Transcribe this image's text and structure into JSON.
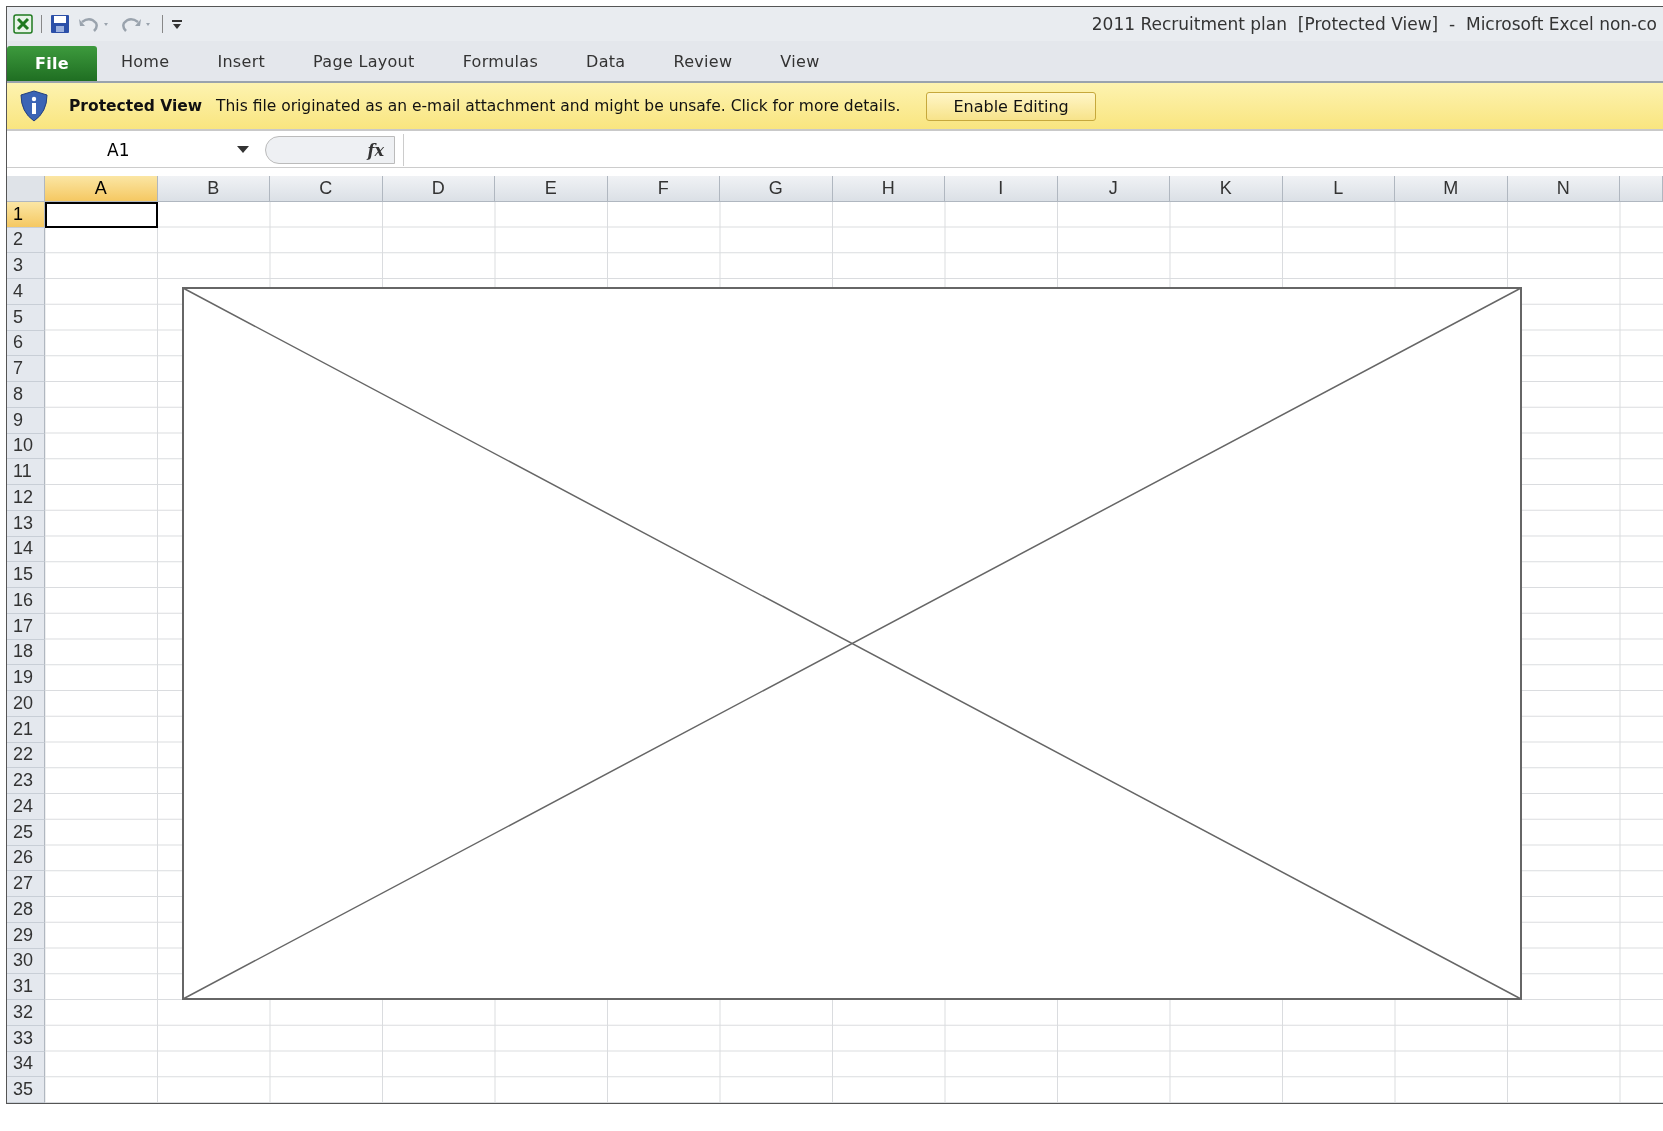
{
  "window": {
    "title": "2011 Recruitment plan  [Protected View]  -  Microsoft Excel non-co"
  },
  "ribbon_tabs": [
    {
      "label": "File",
      "kind": "file"
    },
    {
      "label": "Home",
      "kind": "tab"
    },
    {
      "label": "Insert",
      "kind": "tab"
    },
    {
      "label": "Page Layout",
      "kind": "tab"
    },
    {
      "label": "Formulas",
      "kind": "tab"
    },
    {
      "label": "Data",
      "kind": "tab"
    },
    {
      "label": "Review",
      "kind": "tab"
    },
    {
      "label": "View",
      "kind": "tab"
    }
  ],
  "message_bar": {
    "title": "Protected View",
    "message": "This file originated as an e-mail attachment and might be unsafe. Click for more details.",
    "button": "Enable Editing"
  },
  "formula_bar": {
    "name_box": "A1",
    "function_button": "fx"
  },
  "columns": [
    {
      "label": "A",
      "selected": true
    },
    {
      "label": "B",
      "selected": false
    },
    {
      "label": "C",
      "selected": false
    },
    {
      "label": "D",
      "selected": false
    },
    {
      "label": "E",
      "selected": false
    },
    {
      "label": "F",
      "selected": false
    },
    {
      "label": "G",
      "selected": false
    },
    {
      "label": "H",
      "selected": false
    },
    {
      "label": "I",
      "selected": false
    },
    {
      "label": "J",
      "selected": false
    },
    {
      "label": "K",
      "selected": false
    },
    {
      "label": "L",
      "selected": false
    },
    {
      "label": "M",
      "selected": false
    },
    {
      "label": "N",
      "selected": false
    }
  ],
  "rows": [
    {
      "label": "1",
      "selected": true
    },
    {
      "label": "2",
      "selected": false
    },
    {
      "label": "3",
      "selected": false
    },
    {
      "label": "4",
      "selected": false
    },
    {
      "label": "5",
      "selected": false
    },
    {
      "label": "6",
      "selected": false
    },
    {
      "label": "7",
      "selected": false
    },
    {
      "label": "8",
      "selected": false
    },
    {
      "label": "9",
      "selected": false
    },
    {
      "label": "10",
      "selected": false
    },
    {
      "label": "11",
      "selected": false
    },
    {
      "label": "12",
      "selected": false
    },
    {
      "label": "13",
      "selected": false
    },
    {
      "label": "14",
      "selected": false
    },
    {
      "label": "15",
      "selected": false
    },
    {
      "label": "16",
      "selected": false
    },
    {
      "label": "17",
      "selected": false
    },
    {
      "label": "18",
      "selected": false
    },
    {
      "label": "19",
      "selected": false
    },
    {
      "label": "20",
      "selected": false
    },
    {
      "label": "21",
      "selected": false
    },
    {
      "label": "22",
      "selected": false
    },
    {
      "label": "23",
      "selected": false
    },
    {
      "label": "24",
      "selected": false
    },
    {
      "label": "25",
      "selected": false
    },
    {
      "label": "26",
      "selected": false
    },
    {
      "label": "27",
      "selected": false
    },
    {
      "label": "28",
      "selected": false
    },
    {
      "label": "29",
      "selected": false
    },
    {
      "label": "30",
      "selected": false
    },
    {
      "label": "31",
      "selected": false
    },
    {
      "label": "32",
      "selected": false
    },
    {
      "label": "33",
      "selected": false
    },
    {
      "label": "34",
      "selected": false
    },
    {
      "label": "35",
      "selected": false
    }
  ]
}
